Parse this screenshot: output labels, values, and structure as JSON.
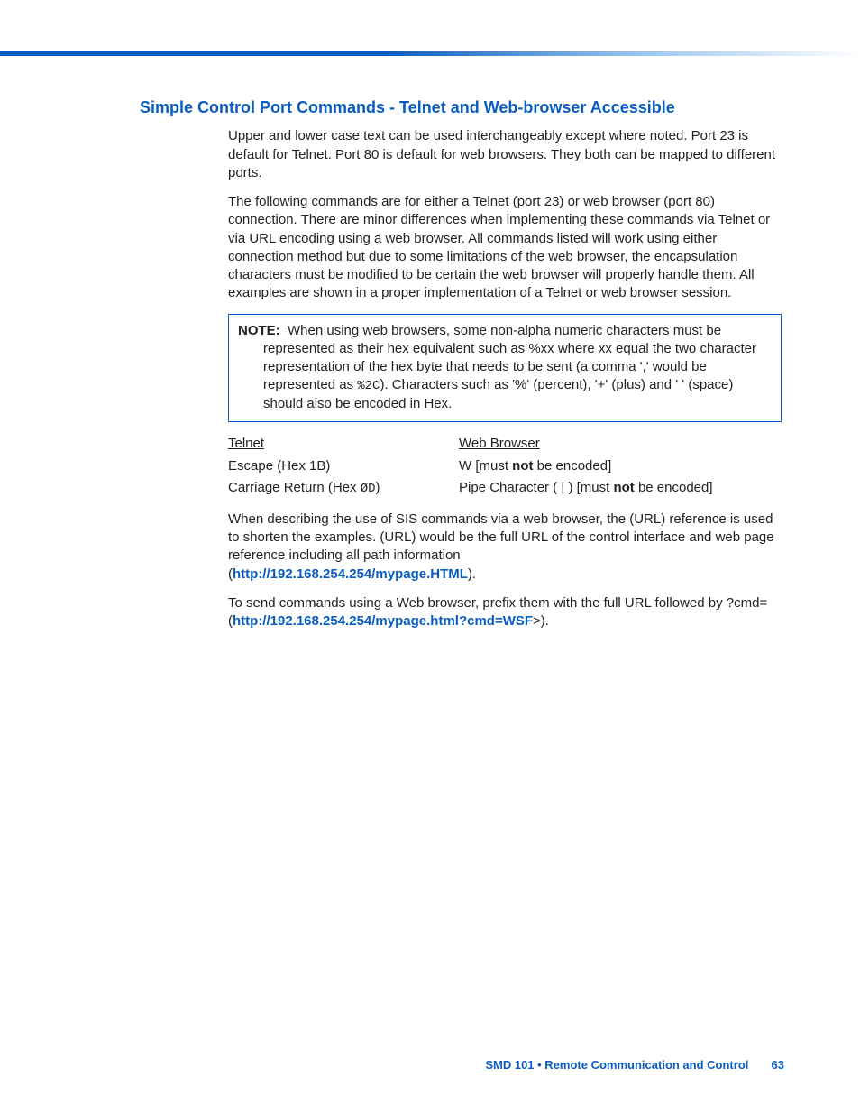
{
  "heading": "Simple Control Port Commands - Telnet and Web-browser Accessible",
  "para1": "Upper and lower case text can be used interchangeably except where noted. Port 23 is default for Telnet. Port 80 is default for web browsers. They both can be mapped to different ports.",
  "para2": "The following commands are for either a Telnet (port 23) or web browser (port 80) connection. There are minor differences when implementing these commands via Telnet or via URL encoding using a web browser. All commands listed will work using either connection method but due to some limitations of the web browser, the encapsulation characters must be modified to be certain the web browser will properly handle them. All examples are shown in a proper implementation of a Telnet or web browser session.",
  "note_label": "NOTE:",
  "note_first": "When using web browsers, some non-alpha numeric characters must be",
  "note_rest_a": "represented as their hex equivalent such as %xx where xx equal the two character representation of the hex byte that needs to be sent (a comma ',' would be represented as ",
  "note_code": "%2C",
  "note_rest_b": "). Characters such as '%' (percent), '+' (plus) and ' ' (space) should also be encoded in Hex.",
  "col1_head": "Telnet",
  "col1_r1": "Escape (Hex 1B)",
  "col1_r2_a": "Carriage Return (Hex ",
  "col1_r2_code": "ØD",
  "col1_r2_b": ")",
  "col2_head": "Web Browser",
  "col2_r1_a": "W [must ",
  "col2_r1_bold": "not",
  "col2_r1_b": " be encoded]",
  "col2_r2_a": "Pipe Character ( | ) [must ",
  "col2_r2_bold": "not",
  "col2_r2_b": " be encoded]",
  "para3": "When describing the use of SIS commands via a web browser, the (URL) reference is used to shorten the examples. (URL) would be the full URL of the control interface and web page reference including all path information",
  "url1_a": "(",
  "url1_link": "http://192.168.254.254/mypage.HTML",
  "url1_b": ").",
  "para4_a": "To send commands using a Web browser, prefix them with the full URL followed by ?cmd= (",
  "url2_link": "http://192.168.254.254/mypage.html?cmd=WSF",
  "para4_b": ">).",
  "footer_text": "SMD 101 • Remote Communication and Control",
  "footer_page": "63"
}
